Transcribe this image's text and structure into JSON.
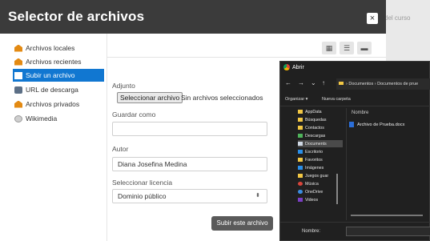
{
  "background": {
    "text": "del curso"
  },
  "picker": {
    "title": "Selector de archivos",
    "close_label": "×",
    "sidebar": [
      {
        "label": "Archivos locales",
        "icon": "repository-icon"
      },
      {
        "label": "Archivos recientes",
        "icon": "repository-icon"
      },
      {
        "label": "Subir un archivo",
        "icon": "upload-icon",
        "active": true
      },
      {
        "label": "URL de descarga",
        "icon": "url-icon"
      },
      {
        "label": "Archivos privados",
        "icon": "repository-icon"
      },
      {
        "label": "Wikimedia",
        "icon": "wikimedia-icon"
      }
    ],
    "toolbar": {
      "view_icons": "▦",
      "view_list": "☰",
      "view_tree": "▬"
    },
    "form": {
      "adjunto_label": "Adjunto",
      "select_file_button": "Seleccionar archivo",
      "file_status": "Sin archivos seleccionados",
      "guardar_como_label": "Guardar como",
      "guardar_como_value": "",
      "autor_label": "Autor",
      "autor_value": "Diana Josefina Medina",
      "licencia_label": "Seleccionar licencia",
      "licencia_value": "Dominio público",
      "licencia_caret": "⬍",
      "submit_button": "Subir este archivo"
    }
  },
  "open_dialog": {
    "title": "Abrir",
    "nav": {
      "back": "←",
      "forward": "→",
      "down": "⌄",
      "up": "↑"
    },
    "address": "› Documentos › Documentos de prue",
    "commands": {
      "organize": "Organizar ▾",
      "new_folder": "Nueva carpeta"
    },
    "nav_items": [
      {
        "label": "AppData",
        "icon": "folder"
      },
      {
        "label": "Búsquedas",
        "icon": "folder"
      },
      {
        "label": "Contactos",
        "icon": "folder"
      },
      {
        "label": "Descargas",
        "icon": "down"
      },
      {
        "label": "Documents",
        "icon": "doc",
        "selected": true
      },
      {
        "label": "Escritorio",
        "icon": "blue"
      },
      {
        "label": "Favoritos",
        "icon": "folder"
      },
      {
        "label": "Imágenes",
        "icon": "blue"
      },
      {
        "label": "Juegos guar",
        "icon": "folder"
      },
      {
        "label": "Música",
        "icon": "red"
      },
      {
        "label": "OneDrive",
        "icon": "cloud"
      },
      {
        "label": "Videos",
        "icon": "vid"
      }
    ],
    "column_header": "Nombre",
    "files": [
      {
        "name": "Archivo de Prueba.docx"
      }
    ],
    "filename_label": "Nombre:",
    "filename_value": ""
  },
  "colors": {
    "header_bg": "#3b3b3b",
    "active_item": "#1177d1",
    "dialog_bg": "#202020"
  }
}
